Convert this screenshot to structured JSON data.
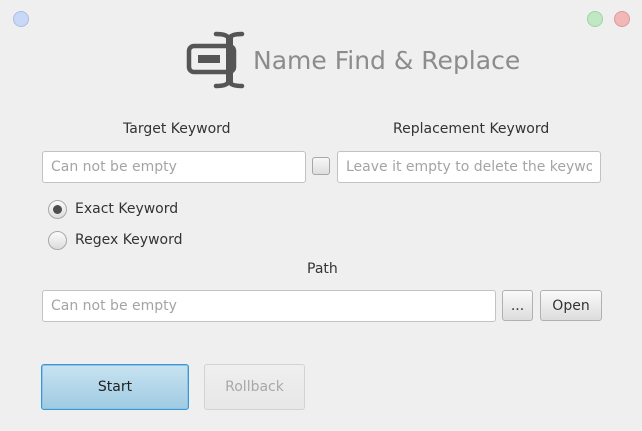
{
  "app": {
    "title": "Name Find & Replace",
    "logo_icon": "rename-cursor-icon"
  },
  "window_controls": {
    "left": "blue-window-dot",
    "right": [
      "green-window-dot",
      "red-window-dot"
    ]
  },
  "target": {
    "label": "Target Keyword",
    "placeholder": "Can not be empty",
    "value": ""
  },
  "replacement": {
    "label": "Replacement Keyword",
    "placeholder": "Leave it empty to delete the keyword",
    "value": "",
    "checkbox_checked": false
  },
  "match_mode": {
    "options": [
      {
        "label": "Exact Keyword",
        "selected": true
      },
      {
        "label": "Regex Keyword",
        "selected": false
      }
    ]
  },
  "path": {
    "label": "Path",
    "placeholder": "Can not be empty",
    "value": "",
    "browse_label": "...",
    "open_label": "Open"
  },
  "actions": {
    "start_label": "Start",
    "rollback_label": "Rollback",
    "rollback_enabled": false
  },
  "colors": {
    "background": "#efefef",
    "start_accent": "#3b97d3",
    "title": "#8c8c8c"
  }
}
